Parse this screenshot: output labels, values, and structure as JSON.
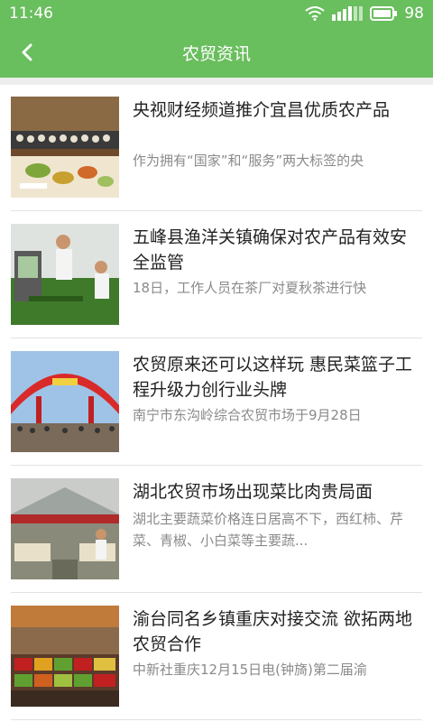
{
  "status_bar": {
    "time": "11:46",
    "battery": "98"
  },
  "header": {
    "title": "农贸资讯"
  },
  "news": [
    {
      "title": "央视财经频道推介宜昌优质农产品",
      "summary": "作为拥有“国家”和“服务”两大标签的央"
    },
    {
      "title": "五峰县渔洋关镇确保对农产品有效安全监管",
      "summary": "18日，工作人员在茶厂对夏秋茶进行快"
    },
    {
      "title": "农贸原来还可以这样玩 惠民菜篮子工程升级力创行业头牌",
      "summary": "南宁市东沟岭综合农贸市场于9月28日"
    },
    {
      "title": "湖北农贸市场出现菜比肉贵局面",
      "summary": "湖北主要蔬菜价格连日居高不下，西红柿、芹菜、青椒、小白菜等主要蔬..."
    },
    {
      "title": "渝台同名乡镇重庆对接交流 欲拓两地农贸合作",
      "summary": "中新社重庆12月15日电(钟旖)第二届渝"
    }
  ]
}
